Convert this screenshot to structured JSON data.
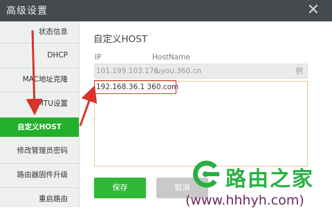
{
  "window": {
    "title": "高级设置",
    "close_label": "✕"
  },
  "sidebar": {
    "items": [
      {
        "label": "状态信息"
      },
      {
        "label": "DHCP"
      },
      {
        "label": "MAC地址克隆"
      },
      {
        "label": "MTU设置"
      },
      {
        "label": "自定义HOST",
        "active": true
      },
      {
        "label": "修改管理员密码"
      },
      {
        "label": "路由器固件升级"
      },
      {
        "label": "重启路由"
      }
    ]
  },
  "main": {
    "title": "自定义HOST",
    "columns": {
      "ip": "IP",
      "hostname": "HostName"
    },
    "default_row": {
      "ip": "101.199.103.176",
      "hostname": "luyou.360.cn",
      "tag": "例"
    },
    "hosts_text": "192.168.36.1 360.com",
    "buttons": {
      "save": "保存",
      "cancel": "取消"
    }
  },
  "watermark": {
    "text": "路由之家",
    "url": "(www.hhhyh.com)"
  },
  "colors": {
    "accent": "#23b02b",
    "highlight": "#d9322a",
    "titlebar": "#454a4e"
  }
}
